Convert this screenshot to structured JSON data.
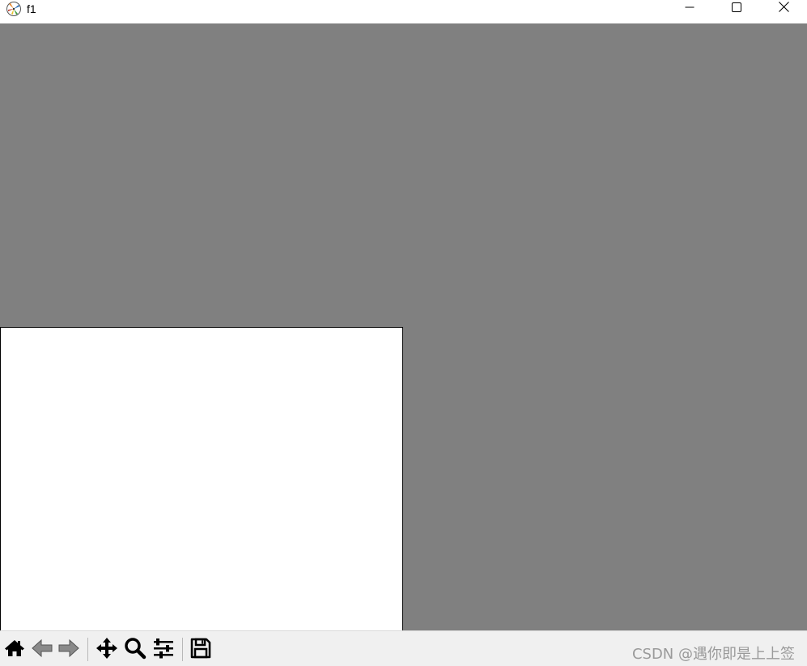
{
  "window": {
    "title": "f1",
    "controls": {
      "minimize": "minimize-icon",
      "maximize": "maximize-icon",
      "close": "close-icon"
    }
  },
  "figure": {
    "background": "#808080",
    "axes_background": "#ffffff"
  },
  "toolbar": {
    "tools": [
      "home-icon",
      "back-arrow-icon",
      "forward-arrow-icon",
      "pan-move-icon",
      "zoom-magnifier-icon",
      "configure-subplots-icon",
      "save-floppy-icon"
    ],
    "watermark": "CSDN @遇你即是上上签"
  }
}
